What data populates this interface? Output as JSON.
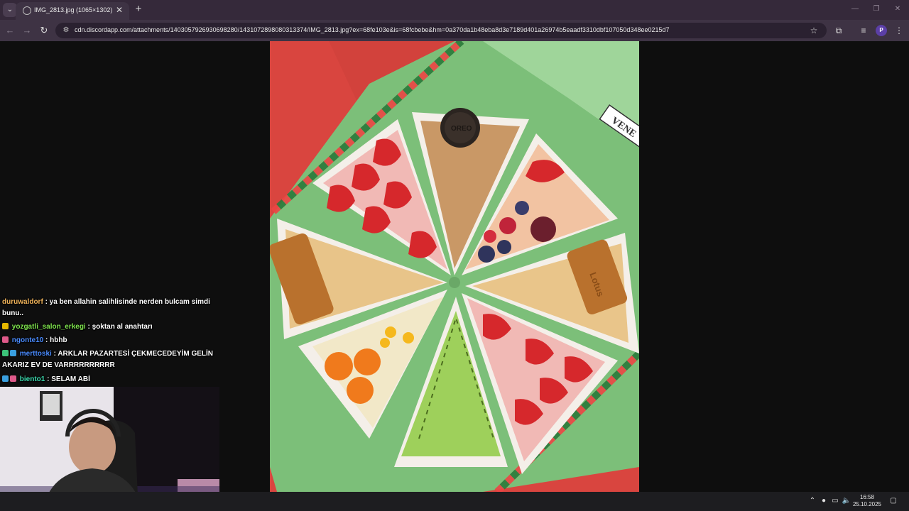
{
  "browser": {
    "tab_title": "IMG_2813.jpg (1065×1302)",
    "new_tab_symbol": "+",
    "close_symbol": "✕",
    "url": "cdn.discordapp.com/attachments/1403057926930698280/1431072898080313374/IMG_2813.jpg?ex=68fe103e&is=68fcbebe&hm=0a370da1b48eba8d3e7189d401a26974b5eaadf3310dbf107050d348ee0215d7",
    "profile_initial": "P",
    "icons": [
      "tab-list-icon",
      "globe-icon",
      "back-icon",
      "forward-icon",
      "reload-icon",
      "site-info-icon",
      "star-icon",
      "extensions-icon",
      "media-queue-icon",
      "profile-icon",
      "menu-icon",
      "minimize-icon",
      "restore-icon",
      "close-window-icon"
    ]
  },
  "photo": {
    "box_label": "VENE",
    "cookie_text": "OREO",
    "biscuit_text": "Lotus",
    "colors": {
      "background_red": "#d9453f",
      "box_green": "#8fc98a",
      "tray_white": "#f4efe9"
    }
  },
  "chat": {
    "messages": [
      {
        "user": "duruwaldorf",
        "user_color": "#f0b35a",
        "text": ": ya ben allahin salihlisinde nerden bulcam simdi bunu..",
        "badges": []
      },
      {
        "user": "yozgatli_salon_erkegi",
        "user_color": "#7ee34d",
        "text": ": şoktan al anahtarı",
        "badges": [
          "#e6b800"
        ]
      },
      {
        "user": "ngonte10",
        "user_color": "#4a8cff",
        "text": ": hbhb",
        "badges": [
          "#e05a8a"
        ]
      },
      {
        "user": "merttoski",
        "user_color": "#4a8cff",
        "text": ": ARKLAR PAZARTESİ ÇEKMECEDEYİM GELİN AKARIZ EV DE VARRRRRRRRRR",
        "badges": [
          "#3cc47a",
          "#3aa0e0"
        ]
      },
      {
        "user": "biento1",
        "user_color": "#3ddcb0",
        "text": ": SELAM ABİ",
        "badges": [
          "#3aa0e0",
          "#e05a8a"
        ]
      }
    ]
  },
  "taskbar": {
    "time": "16:58",
    "date": "25.10.2025",
    "tray_icons": [
      "chevron-up-icon",
      "microphone-icon",
      "network-icon",
      "volume-icon",
      "notification-icon"
    ]
  }
}
